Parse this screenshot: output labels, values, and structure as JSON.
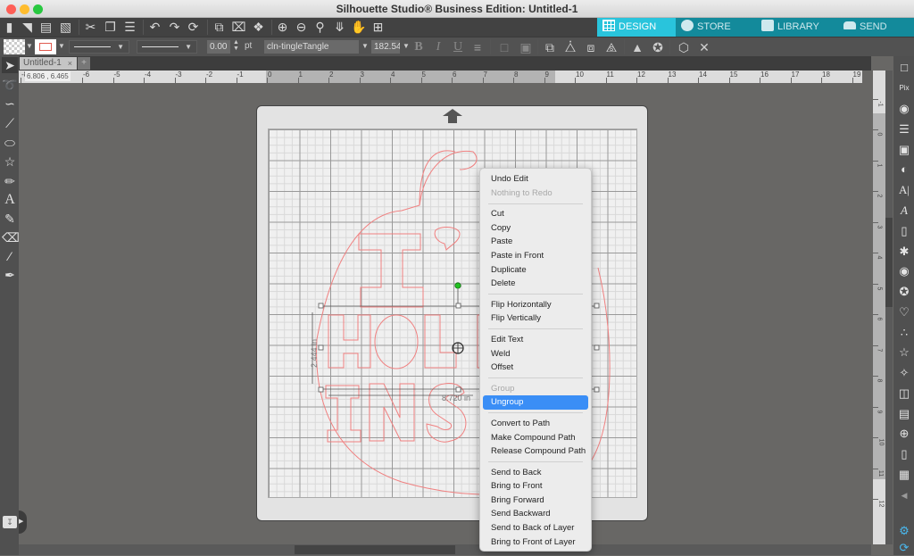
{
  "window": {
    "title": "Silhouette Studio® Business Edition: Untitled-1"
  },
  "nav_tabs": [
    {
      "label": "DESIGN",
      "icon": "grid-icon",
      "active": true
    },
    {
      "label": "STORE",
      "icon": "silhouette-s-icon",
      "active": false
    },
    {
      "label": "LIBRARY",
      "icon": "library-icon",
      "active": false
    },
    {
      "label": "SEND",
      "icon": "cutter-icon",
      "active": false
    }
  ],
  "toolbar": {
    "icons": [
      "new-file-icon",
      "open-folder-icon",
      "save-icon",
      "print-icon",
      "cut-icon",
      "copy-icon",
      "paste-icon",
      "undo-icon",
      "redo-icon",
      "redraw-icon",
      "group-icon",
      "ungroup-icon",
      "compound-icon",
      "zoom-in-icon",
      "zoom-out-icon",
      "zoom-select-icon",
      "fit-page-icon",
      "pan-hand-icon",
      "add-page-icon"
    ]
  },
  "properties": {
    "line_width": "0.00",
    "line_unit": "pt",
    "font_name": "cln-tingleTangle",
    "font_size": "182.54",
    "bold": "B",
    "italic": "I",
    "underline": "U"
  },
  "document_tab": {
    "label": "Untitled-1",
    "close": "×",
    "add": "+"
  },
  "ruler": {
    "coord_readout": "6.806 , 6.465",
    "h_ticks": [
      "-8",
      "-6",
      "-5",
      "-4",
      "-3",
      "-2",
      "-1",
      "0",
      "1",
      "2",
      "3",
      "4",
      "5",
      "6",
      "7",
      "8",
      "9",
      "10",
      "11",
      "12",
      "13",
      "14",
      "15",
      "16",
      "17",
      "18",
      "19"
    ],
    "v_ticks": [
      "-1",
      "0",
      "1",
      "2",
      "3",
      "4",
      "5",
      "6",
      "7",
      "8",
      "9",
      "10",
      "11",
      "12"
    ]
  },
  "selection": {
    "width_label": "8.720 in",
    "height_label": "2.444 in"
  },
  "design": {
    "text_lines": [
      "I'",
      "HOLL",
      "INSI"
    ],
    "stroke_color": "#f08080"
  },
  "context_menu": {
    "groups": [
      [
        {
          "label": "Undo Edit",
          "enabled": true
        },
        {
          "label": "Nothing to Redo",
          "enabled": false
        }
      ],
      [
        {
          "label": "Cut",
          "enabled": true
        },
        {
          "label": "Copy",
          "enabled": true
        },
        {
          "label": "Paste",
          "enabled": true
        },
        {
          "label": "Paste in Front",
          "enabled": true
        },
        {
          "label": "Duplicate",
          "enabled": true
        },
        {
          "label": "Delete",
          "enabled": true
        }
      ],
      [
        {
          "label": "Flip Horizontally",
          "enabled": true
        },
        {
          "label": "Flip Vertically",
          "enabled": true
        }
      ],
      [
        {
          "label": "Edit Text",
          "enabled": true
        },
        {
          "label": "Weld",
          "enabled": true
        },
        {
          "label": "Offset",
          "enabled": true
        }
      ],
      [
        {
          "label": "Group",
          "enabled": false
        },
        {
          "label": "Ungroup",
          "enabled": true,
          "highlighted": true
        }
      ],
      [
        {
          "label": "Convert to Path",
          "enabled": true
        },
        {
          "label": "Make Compound Path",
          "enabled": true
        },
        {
          "label": "Release Compound Path",
          "enabled": true
        }
      ],
      [
        {
          "label": "Send to Back",
          "enabled": true
        },
        {
          "label": "Bring to Front",
          "enabled": true
        },
        {
          "label": "Bring Forward",
          "enabled": true
        },
        {
          "label": "Send Backward",
          "enabled": true
        },
        {
          "label": "Send to Back of Layer",
          "enabled": true
        },
        {
          "label": "Bring to Front of Layer",
          "enabled": true
        }
      ]
    ]
  },
  "colors": {
    "accent_active": "#29c4dc",
    "accent_tab": "#138a9b",
    "menu_highlight": "#3a8ef6"
  }
}
